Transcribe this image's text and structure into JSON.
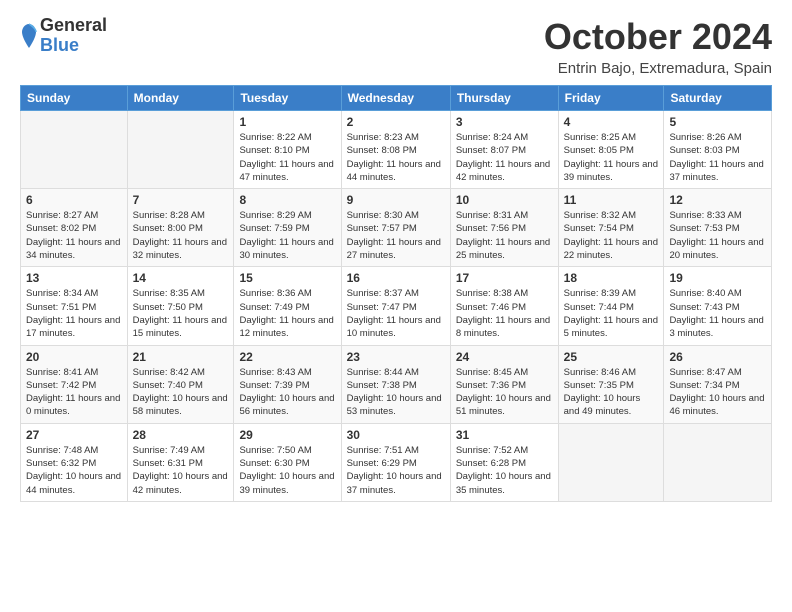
{
  "header": {
    "logo": {
      "general": "General",
      "blue": "Blue"
    },
    "title": "October 2024",
    "location": "Entrin Bajo, Extremadura, Spain"
  },
  "columns": [
    "Sunday",
    "Monday",
    "Tuesday",
    "Wednesday",
    "Thursday",
    "Friday",
    "Saturday"
  ],
  "weeks": [
    [
      {
        "day": "",
        "info": ""
      },
      {
        "day": "",
        "info": ""
      },
      {
        "day": "1",
        "info": "Sunrise: 8:22 AM\nSunset: 8:10 PM\nDaylight: 11 hours and 47 minutes."
      },
      {
        "day": "2",
        "info": "Sunrise: 8:23 AM\nSunset: 8:08 PM\nDaylight: 11 hours and 44 minutes."
      },
      {
        "day": "3",
        "info": "Sunrise: 8:24 AM\nSunset: 8:07 PM\nDaylight: 11 hours and 42 minutes."
      },
      {
        "day": "4",
        "info": "Sunrise: 8:25 AM\nSunset: 8:05 PM\nDaylight: 11 hours and 39 minutes."
      },
      {
        "day": "5",
        "info": "Sunrise: 8:26 AM\nSunset: 8:03 PM\nDaylight: 11 hours and 37 minutes."
      }
    ],
    [
      {
        "day": "6",
        "info": "Sunrise: 8:27 AM\nSunset: 8:02 PM\nDaylight: 11 hours and 34 minutes."
      },
      {
        "day": "7",
        "info": "Sunrise: 8:28 AM\nSunset: 8:00 PM\nDaylight: 11 hours and 32 minutes."
      },
      {
        "day": "8",
        "info": "Sunrise: 8:29 AM\nSunset: 7:59 PM\nDaylight: 11 hours and 30 minutes."
      },
      {
        "day": "9",
        "info": "Sunrise: 8:30 AM\nSunset: 7:57 PM\nDaylight: 11 hours and 27 minutes."
      },
      {
        "day": "10",
        "info": "Sunrise: 8:31 AM\nSunset: 7:56 PM\nDaylight: 11 hours and 25 minutes."
      },
      {
        "day": "11",
        "info": "Sunrise: 8:32 AM\nSunset: 7:54 PM\nDaylight: 11 hours and 22 minutes."
      },
      {
        "day": "12",
        "info": "Sunrise: 8:33 AM\nSunset: 7:53 PM\nDaylight: 11 hours and 20 minutes."
      }
    ],
    [
      {
        "day": "13",
        "info": "Sunrise: 8:34 AM\nSunset: 7:51 PM\nDaylight: 11 hours and 17 minutes."
      },
      {
        "day": "14",
        "info": "Sunrise: 8:35 AM\nSunset: 7:50 PM\nDaylight: 11 hours and 15 minutes."
      },
      {
        "day": "15",
        "info": "Sunrise: 8:36 AM\nSunset: 7:49 PM\nDaylight: 11 hours and 12 minutes."
      },
      {
        "day": "16",
        "info": "Sunrise: 8:37 AM\nSunset: 7:47 PM\nDaylight: 11 hours and 10 minutes."
      },
      {
        "day": "17",
        "info": "Sunrise: 8:38 AM\nSunset: 7:46 PM\nDaylight: 11 hours and 8 minutes."
      },
      {
        "day": "18",
        "info": "Sunrise: 8:39 AM\nSunset: 7:44 PM\nDaylight: 11 hours and 5 minutes."
      },
      {
        "day": "19",
        "info": "Sunrise: 8:40 AM\nSunset: 7:43 PM\nDaylight: 11 hours and 3 minutes."
      }
    ],
    [
      {
        "day": "20",
        "info": "Sunrise: 8:41 AM\nSunset: 7:42 PM\nDaylight: 11 hours and 0 minutes."
      },
      {
        "day": "21",
        "info": "Sunrise: 8:42 AM\nSunset: 7:40 PM\nDaylight: 10 hours and 58 minutes."
      },
      {
        "day": "22",
        "info": "Sunrise: 8:43 AM\nSunset: 7:39 PM\nDaylight: 10 hours and 56 minutes."
      },
      {
        "day": "23",
        "info": "Sunrise: 8:44 AM\nSunset: 7:38 PM\nDaylight: 10 hours and 53 minutes."
      },
      {
        "day": "24",
        "info": "Sunrise: 8:45 AM\nSunset: 7:36 PM\nDaylight: 10 hours and 51 minutes."
      },
      {
        "day": "25",
        "info": "Sunrise: 8:46 AM\nSunset: 7:35 PM\nDaylight: 10 hours and 49 minutes."
      },
      {
        "day": "26",
        "info": "Sunrise: 8:47 AM\nSunset: 7:34 PM\nDaylight: 10 hours and 46 minutes."
      }
    ],
    [
      {
        "day": "27",
        "info": "Sunrise: 7:48 AM\nSunset: 6:32 PM\nDaylight: 10 hours and 44 minutes."
      },
      {
        "day": "28",
        "info": "Sunrise: 7:49 AM\nSunset: 6:31 PM\nDaylight: 10 hours and 42 minutes."
      },
      {
        "day": "29",
        "info": "Sunrise: 7:50 AM\nSunset: 6:30 PM\nDaylight: 10 hours and 39 minutes."
      },
      {
        "day": "30",
        "info": "Sunrise: 7:51 AM\nSunset: 6:29 PM\nDaylight: 10 hours and 37 minutes."
      },
      {
        "day": "31",
        "info": "Sunrise: 7:52 AM\nSunset: 6:28 PM\nDaylight: 10 hours and 35 minutes."
      },
      {
        "day": "",
        "info": ""
      },
      {
        "day": "",
        "info": ""
      }
    ]
  ]
}
